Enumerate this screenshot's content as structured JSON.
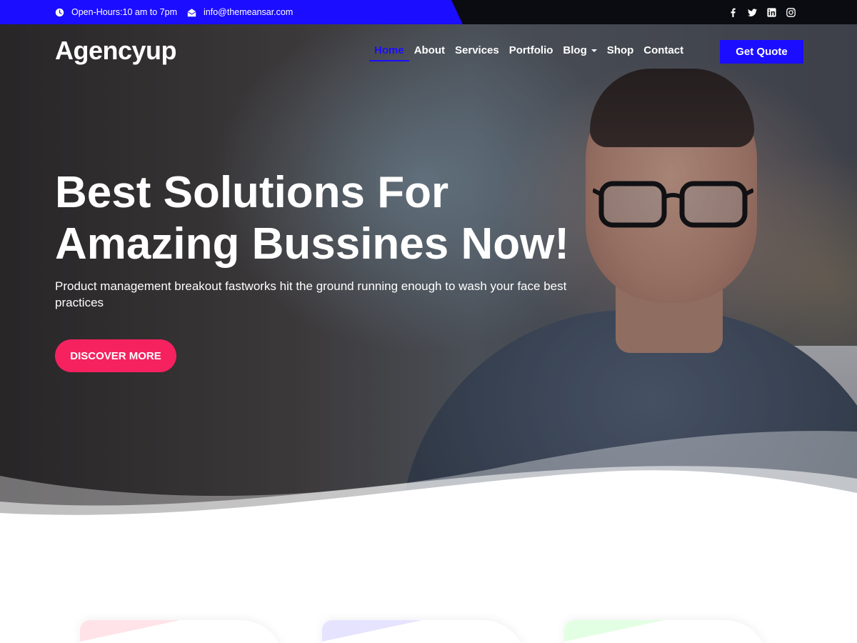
{
  "topbar": {
    "hours": "Open-Hours:10 am to 7pm",
    "email": "info@themeansar.com",
    "hours_icon": "clock-icon",
    "email_icon": "envelope-open-icon",
    "social": [
      "facebook-icon",
      "twitter-icon",
      "linkedin-icon",
      "instagram-icon"
    ]
  },
  "header": {
    "logo": "Agencyup",
    "nav": [
      {
        "label": "Home",
        "active": true
      },
      {
        "label": "About"
      },
      {
        "label": "Services"
      },
      {
        "label": "Portfolio"
      },
      {
        "label": "Blog",
        "dropdown": true
      },
      {
        "label": "Shop"
      },
      {
        "label": "Contact"
      }
    ],
    "cta": "Get Quote"
  },
  "hero": {
    "title_line1": "Best Solutions For",
    "title_line2": "Amazing Bussines Now!",
    "description": "Product management breakout fastworks hit the ground running enough to wash your face best practices",
    "button": "DISCOVER MORE"
  },
  "colors": {
    "accent_blue": "#1b0dff",
    "accent_pink": "#f5225f",
    "topbar_dark": "#0b0b12",
    "card_pink": "#ffe3e8",
    "card_purple": "#e6e3ff",
    "card_green": "#e3ffe3"
  }
}
